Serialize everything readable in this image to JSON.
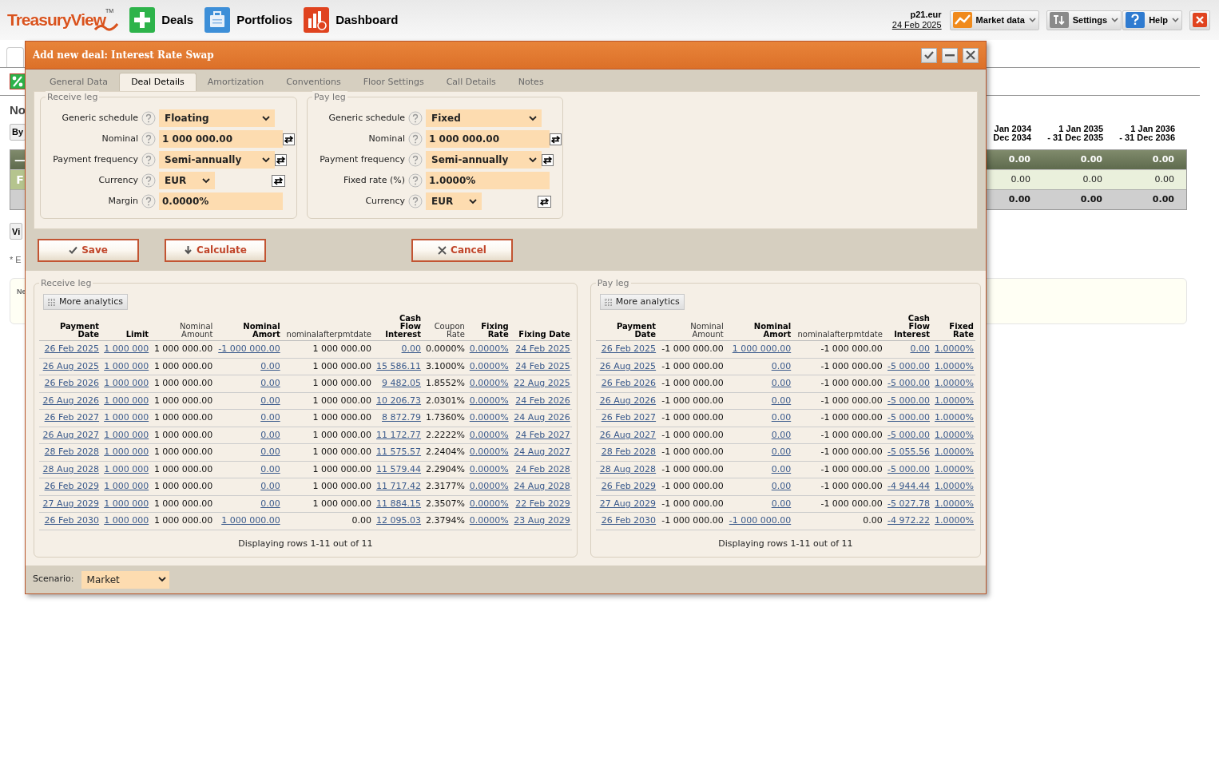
{
  "app_header": {
    "logo": "TreasuryView",
    "logo_mark": "TM",
    "nav": [
      {
        "label": "Deals",
        "kind": "deals"
      },
      {
        "label": "Portfolios",
        "kind": "portfolios"
      },
      {
        "label": "Dashboard",
        "kind": "dashboard"
      }
    ],
    "account": "p21.eur",
    "date": "24 Feb 2025",
    "menus": [
      {
        "label": "Market data",
        "kind": "market"
      },
      {
        "label": "Settings",
        "kind": "settings"
      },
      {
        "label": "Help",
        "kind": "help"
      }
    ]
  },
  "background": {
    "heading": "No",
    "buttons": [
      "By",
      "Vi"
    ],
    "note": "* E",
    "box_title": "Ne",
    "summary_table": {
      "columns": [
        "Jan 2034\nDec 2034",
        "1 Jan 2035\n- 31 Dec 2035",
        "1 Jan 2036\n- 31 Dec 2036"
      ],
      "rows": [
        {
          "kind": "group",
          "label": "—",
          "values": [
            "0.00",
            "0.00",
            "0.00"
          ]
        },
        {
          "kind": "item",
          "label": "F",
          "values": [
            "0.00",
            "0.00",
            "0.00"
          ]
        },
        {
          "kind": "total",
          "values": [
            "0.00",
            "0.00",
            "0.00"
          ]
        }
      ]
    }
  },
  "dialog": {
    "title": "Add new deal: Interest Rate Swap",
    "tabs": [
      {
        "label": "General Data",
        "selected": false
      },
      {
        "label": "Deal Details",
        "selected": true
      },
      {
        "label": "Amortization",
        "selected": false
      },
      {
        "label": "Conventions",
        "selected": false
      },
      {
        "label": "Floor Settings",
        "selected": false
      },
      {
        "label": "Call Details",
        "selected": false
      },
      {
        "label": "Notes",
        "selected": false
      }
    ],
    "legs": [
      {
        "title": "Receive leg",
        "fields": [
          {
            "label": "Generic schedule",
            "kind": "select",
            "value": "Floating",
            "swap": false
          },
          {
            "label": "Nominal",
            "kind": "input",
            "value": "1 000 000.00",
            "swap": true
          },
          {
            "label": "Payment frequency",
            "kind": "select",
            "value": "Semi-annually",
            "swap": true
          },
          {
            "label": "Currency",
            "kind": "short_select",
            "value": "EUR",
            "swap": true
          },
          {
            "label": "Margin",
            "kind": "input",
            "value": "0.0000%",
            "swap": false
          }
        ]
      },
      {
        "title": "Pay leg",
        "fields": [
          {
            "label": "Generic schedule",
            "kind": "select",
            "value": "Fixed",
            "swap": false
          },
          {
            "label": "Nominal",
            "kind": "input",
            "value": "1 000 000.00",
            "swap": true
          },
          {
            "label": "Payment frequency",
            "kind": "select",
            "value": "Semi-annually",
            "swap": true
          },
          {
            "label": "Fixed rate (%)",
            "kind": "input",
            "value": "1.0000%",
            "swap": false
          },
          {
            "label": "Currency",
            "kind": "short_select",
            "value": "EUR",
            "swap": true
          }
        ]
      }
    ],
    "actions": [
      {
        "label": "Save",
        "kind": "save"
      },
      {
        "label": "Calculate",
        "kind": "calculate"
      },
      {
        "label": "Cancel",
        "kind": "cancel"
      }
    ],
    "schedules": [
      {
        "title": "Receive leg",
        "analytics_button": "More analytics",
        "footer": "Displaying rows 1-11 out of 11",
        "columns": [
          {
            "label": "Payment\nDate",
            "bold": true,
            "link": true
          },
          {
            "label": "Limit",
            "bold": true,
            "link": true
          },
          {
            "label": "Nominal\nAmount",
            "bold": false,
            "link": false
          },
          {
            "label": "Nominal\nAmort",
            "bold": true,
            "link": true
          },
          {
            "label": "nominalafterpmtdate",
            "bold": false,
            "link": false
          },
          {
            "label": "Cash\nFlow\nInterest",
            "bold": true,
            "link": true
          },
          {
            "label": "Coupon\nRate",
            "bold": false,
            "link": false
          },
          {
            "label": "Fixing\nRate",
            "bold": true,
            "link": true
          },
          {
            "label": "Fixing Date",
            "bold": true,
            "link": true
          }
        ],
        "rows": [
          [
            "26 Feb 2025",
            "1 000 000",
            "1 000 000.00",
            "-1 000 000.00",
            "1 000 000.00",
            "0.00",
            "0.0000%",
            "0.0000%",
            "24 Feb 2025"
          ],
          [
            "26 Aug 2025",
            "1 000 000",
            "1 000 000.00",
            "0.00",
            "1 000 000.00",
            "15 586.11",
            "3.1000%",
            "0.0000%",
            "24 Feb 2025"
          ],
          [
            "26 Feb 2026",
            "1 000 000",
            "1 000 000.00",
            "0.00",
            "1 000 000.00",
            "9 482.05",
            "1.8552%",
            "0.0000%",
            "22 Aug 2025"
          ],
          [
            "26 Aug 2026",
            "1 000 000",
            "1 000 000.00",
            "0.00",
            "1 000 000.00",
            "10 206.73",
            "2.0301%",
            "0.0000%",
            "24 Feb 2026"
          ],
          [
            "26 Feb 2027",
            "1 000 000",
            "1 000 000.00",
            "0.00",
            "1 000 000.00",
            "8 872.79",
            "1.7360%",
            "0.0000%",
            "24 Aug 2026"
          ],
          [
            "26 Aug 2027",
            "1 000 000",
            "1 000 000.00",
            "0.00",
            "1 000 000.00",
            "11 172.77",
            "2.2222%",
            "0.0000%",
            "24 Feb 2027"
          ],
          [
            "28 Feb 2028",
            "1 000 000",
            "1 000 000.00",
            "0.00",
            "1 000 000.00",
            "11 575.57",
            "2.2404%",
            "0.0000%",
            "24 Aug 2027"
          ],
          [
            "28 Aug 2028",
            "1 000 000",
            "1 000 000.00",
            "0.00",
            "1 000 000.00",
            "11 579.44",
            "2.2904%",
            "0.0000%",
            "24 Feb 2028"
          ],
          [
            "26 Feb 2029",
            "1 000 000",
            "1 000 000.00",
            "0.00",
            "1 000 000.00",
            "11 717.42",
            "2.3177%",
            "0.0000%",
            "24 Aug 2028"
          ],
          [
            "27 Aug 2029",
            "1 000 000",
            "1 000 000.00",
            "0.00",
            "1 000 000.00",
            "11 884.15",
            "2.3507%",
            "0.0000%",
            "22 Feb 2029"
          ],
          [
            "26 Feb 2030",
            "1 000 000",
            "1 000 000.00",
            "1 000 000.00",
            "0.00",
            "12 095.03",
            "2.3794%",
            "0.0000%",
            "23 Aug 2029"
          ]
        ]
      },
      {
        "title": "Pay leg",
        "analytics_button": "More analytics",
        "footer": "Displaying rows 1-11 out of 11",
        "columns": [
          {
            "label": "Payment\nDate",
            "bold": true,
            "link": true
          },
          {
            "label": "Nominal\nAmount",
            "bold": false,
            "link": false
          },
          {
            "label": "Nominal\nAmort",
            "bold": true,
            "link": true
          },
          {
            "label": "nominalafterpmtdate",
            "bold": false,
            "link": false
          },
          {
            "label": "Cash\nFlow\nInterest",
            "bold": true,
            "link": true
          },
          {
            "label": "Fixed\nRate",
            "bold": true,
            "link": true
          }
        ],
        "rows": [
          [
            "26 Feb 2025",
            "-1 000 000.00",
            "1 000 000.00",
            "-1 000 000.00",
            "0.00",
            "1.0000%"
          ],
          [
            "26 Aug 2025",
            "-1 000 000.00",
            "0.00",
            "-1 000 000.00",
            "-5 000.00",
            "1.0000%"
          ],
          [
            "26 Feb 2026",
            "-1 000 000.00",
            "0.00",
            "-1 000 000.00",
            "-5 000.00",
            "1.0000%"
          ],
          [
            "26 Aug 2026",
            "-1 000 000.00",
            "0.00",
            "-1 000 000.00",
            "-5 000.00",
            "1.0000%"
          ],
          [
            "26 Feb 2027",
            "-1 000 000.00",
            "0.00",
            "-1 000 000.00",
            "-5 000.00",
            "1.0000%"
          ],
          [
            "26 Aug 2027",
            "-1 000 000.00",
            "0.00",
            "-1 000 000.00",
            "-5 000.00",
            "1.0000%"
          ],
          [
            "28 Feb 2028",
            "-1 000 000.00",
            "0.00",
            "-1 000 000.00",
            "-5 055.56",
            "1.0000%"
          ],
          [
            "28 Aug 2028",
            "-1 000 000.00",
            "0.00",
            "-1 000 000.00",
            "-5 000.00",
            "1.0000%"
          ],
          [
            "26 Feb 2029",
            "-1 000 000.00",
            "0.00",
            "-1 000 000.00",
            "-4 944.44",
            "1.0000%"
          ],
          [
            "27 Aug 2029",
            "-1 000 000.00",
            "0.00",
            "-1 000 000.00",
            "-5 027.78",
            "1.0000%"
          ],
          [
            "26 Feb 2030",
            "-1 000 000.00",
            "-1 000 000.00",
            "0.00",
            "-4 972.22",
            "1.0000%"
          ]
        ]
      }
    ],
    "scenario": {
      "label": "Scenario:",
      "value": "Market"
    }
  }
}
